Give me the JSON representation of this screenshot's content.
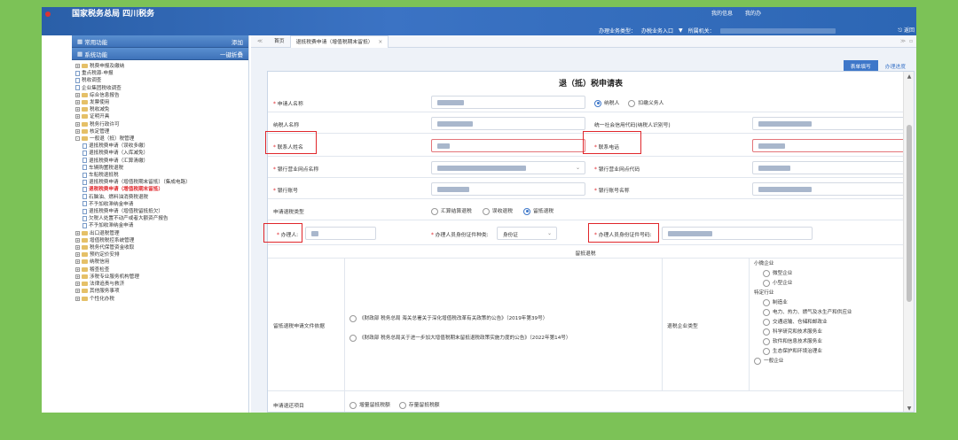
{
  "header": {
    "site_title": "国家税务总局 四川税务",
    "link_my_info": "我的信息",
    "link_me": "我的办",
    "biz_type_label": "办理业务类型：",
    "biz_type_value": "办税业务入口",
    "dropdown_arrow": "▼",
    "org_label": "所属机关：",
    "exit_label": "返回"
  },
  "sidebar": {
    "common": {
      "label": "常用功能",
      "action": "添加"
    },
    "system": {
      "label": "系统功能",
      "action": "一键折叠"
    },
    "tree": [
      {
        "level": 1,
        "type": "folder",
        "expander": "+",
        "label": "税费申报及缴纳"
      },
      {
        "level": 1,
        "type": "file",
        "label": "重点税源-申报"
      },
      {
        "level": 1,
        "type": "file",
        "label": "税收调查"
      },
      {
        "level": 1,
        "type": "file",
        "label": "企业集团税收调查"
      },
      {
        "level": 1,
        "type": "folder",
        "expander": "+",
        "label": "综合信息报告"
      },
      {
        "level": 1,
        "type": "folder",
        "expander": "+",
        "label": "发票使用"
      },
      {
        "level": 1,
        "type": "folder",
        "expander": "+",
        "label": "税收减免"
      },
      {
        "level": 1,
        "type": "folder",
        "expander": "+",
        "label": "证明开具"
      },
      {
        "level": 1,
        "type": "folder",
        "expander": "+",
        "label": "税务行政许可"
      },
      {
        "level": 1,
        "type": "folder",
        "expander": "+",
        "label": "核定管理"
      },
      {
        "level": 1,
        "type": "folder",
        "expander": "-",
        "label": "一般退（抵）税管理"
      },
      {
        "level": 2,
        "type": "file",
        "label": "退抵税费申请（误收多缴）"
      },
      {
        "level": 2,
        "type": "file",
        "label": "退抵税费申请（入库减免）"
      },
      {
        "level": 2,
        "type": "file",
        "label": "退抵税费申请（汇算清缴）"
      },
      {
        "level": 2,
        "type": "file",
        "label": "车辆购置税退税"
      },
      {
        "level": 2,
        "type": "file",
        "label": "车船税退抵税"
      },
      {
        "level": 2,
        "type": "file",
        "label": "退抵税费申请（增值税期末留抵）（集成电路）"
      },
      {
        "level": 2,
        "type": "file",
        "label": "退税税费申请（增值税期末留抵）",
        "highlight": true
      },
      {
        "level": 2,
        "type": "file",
        "label": "石脑油、燃料油消费税退税"
      },
      {
        "level": 2,
        "type": "file",
        "label": "不予加收滞纳金申请"
      },
      {
        "level": 2,
        "type": "file",
        "label": "退抵税费申请（增值税留抵抵欠）"
      },
      {
        "level": 2,
        "type": "file",
        "label": "欠税人处置不动产或者大额资产报告"
      },
      {
        "level": 2,
        "type": "file",
        "label": "不予加收滞纳金申请"
      },
      {
        "level": 1,
        "type": "folder",
        "expander": "+",
        "label": "出口退税管理"
      },
      {
        "level": 1,
        "type": "folder",
        "expander": "+",
        "label": "增值税税控系统管理"
      },
      {
        "level": 1,
        "type": "folder",
        "expander": "+",
        "label": "税务代保管资金收取"
      },
      {
        "level": 1,
        "type": "folder",
        "expander": "+",
        "label": "预约定价安排"
      },
      {
        "level": 1,
        "type": "folder",
        "expander": "+",
        "label": "纳税信用"
      },
      {
        "level": 1,
        "type": "folder",
        "expander": "+",
        "label": "稽查检查"
      },
      {
        "level": 1,
        "type": "folder",
        "expander": "+",
        "label": "涉税专业服务机构管理"
      },
      {
        "level": 1,
        "type": "folder",
        "expander": "+",
        "label": "法律追责与救济"
      },
      {
        "level": 1,
        "type": "folder",
        "expander": "+",
        "label": "其他服务事项"
      },
      {
        "level": 1,
        "type": "folder",
        "expander": "+",
        "label": "个性化办税"
      }
    ]
  },
  "tabs": {
    "prev": "≪",
    "home": "首页",
    "active": "退抵税费申请（增值税期末留抵）",
    "close": "×",
    "next": "≫",
    "menu": "▫"
  },
  "subtabs": {
    "fill": "表单填写",
    "progress": "办理进度"
  },
  "form": {
    "title": "退（抵）税申请表",
    "applicant_name_label": "申请人名称",
    "taxpayer_option": "纳税人",
    "withholder_option": "扣缴义务人",
    "taxpayer_name_label": "纳税人名称",
    "credit_code_label": "统一社会信用代码(纳税人识别号)",
    "contact_name_label": "联系人姓名",
    "contact_phone_label": "联系电话",
    "bank_name_label": "银行营业网点名称",
    "bank_code_label": "银行营业网点代码",
    "account_no_label": "银行账号",
    "account_name_label": "银行账号名称",
    "apply_type_label": "申请退税类型",
    "type_options": [
      "汇算结算退税",
      "误收退税",
      "留抵退税"
    ],
    "handler_label": "办理人:",
    "id_type_label": "办理人员身份证件种类:",
    "id_type_value": "身份证",
    "id_no_label": "办理人员身份证件号码:",
    "section_refund": "留抵退税",
    "policy_label": "留抵退税申请文件依据",
    "policies": [
      "《财政部 税务总局 海关总署关于深化增值税改革有关政策的公告》（2019年第39号）",
      "《财政部 税务总局关于进一步加大增值税期末留抵退税政策实施力度的公告》（2022年第14号）"
    ],
    "enterprise_type_label": "退税企业类型",
    "small_micro_label": "小微企业",
    "small_micro_options": [
      "微型企业",
      "小型企业"
    ],
    "specific_label": "特定行业",
    "specific_options": [
      "制造业",
      "电力、热力、燃气及水生产和供应业",
      "交通运输、仓储和邮政业",
      "科学研究和技术服务业",
      "软件和信息技术服务业",
      "生态保护和环境治理业"
    ],
    "general_option": "一般企业",
    "bottom_label": "申请退还项目",
    "bottom_options": [
      "增量留抵税额",
      "存量留抵税额"
    ]
  },
  "scrollbar": {
    "up": "▲",
    "down": "▼"
  },
  "colors": {
    "accent": "#3e77c9",
    "error": "#e0262b",
    "background": "#7cc257"
  }
}
